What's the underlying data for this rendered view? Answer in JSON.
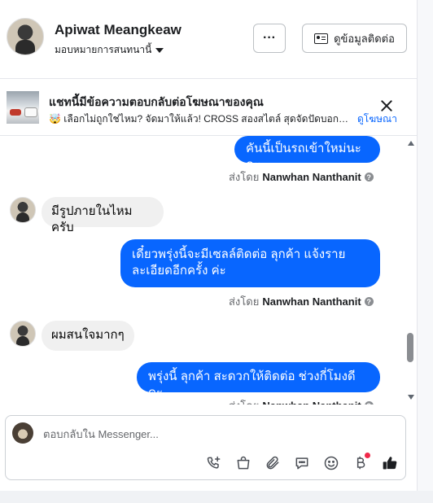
{
  "header": {
    "name": "Apiwat Meangkeaw",
    "assign_label": "มอบหมายการสนทนานี้",
    "more_label": "···",
    "info_label": "ดูข้อมูลติดต่อ"
  },
  "ad": {
    "title": "แชทนี้มีข้อความตอบกลับต่อโฆษณาของคุณ",
    "subtitle": "🤯 เลือกไม่ถูกใช่ไหม? จัดมาให้แล้ว! CROSS สองสไตล์ สุดจัดปัดบอก! …",
    "view_ad_label": "ดูโฆษณา"
  },
  "messages": [
    {
      "direction": "out",
      "text": "คันนี้เป็นรถเข้าใหม่นะคะ"
    },
    {
      "direction": "in",
      "text": "มีรูปภายในไหมครับ"
    },
    {
      "direction": "out",
      "text": "เดี๋ยวพรุ่งนี้จะมีเซลล์ติดต่อ ลุกค้า  แจ้งรายละเอียดอีกครั้ง ค่ะ"
    },
    {
      "direction": "in",
      "text": "ผมสนใจมากๆ"
    },
    {
      "direction": "out",
      "text": "พรุ่งนี้ ลุกค้า สะดวกให้ติดต่อ ช่วงกี่โมงดีคะ"
    }
  ],
  "sent_by": {
    "prefix": "ส่งโดย",
    "agent": "Nanwhan Nanthanit"
  },
  "composer": {
    "placeholder": "ตอบกลับใน Messenger..."
  },
  "icons": {
    "call": "phone-plus-icon",
    "shop": "shopping-bag-icon",
    "attach": "paperclip-icon",
    "quick_reply": "chat-bubble-icon",
    "emoji": "smiley-icon",
    "payment": "baht-icon",
    "like": "thumbs-up-icon"
  },
  "colors": {
    "accent": "#0866ff",
    "incoming_bubble": "#f0f0f0",
    "notification_dot": "#f02849"
  }
}
